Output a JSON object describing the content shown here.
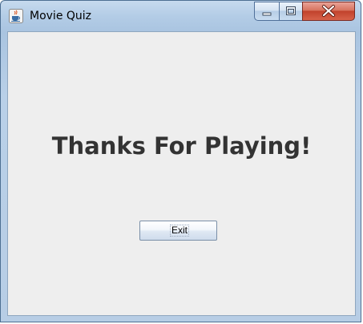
{
  "window": {
    "title": "Movie Quiz"
  },
  "main": {
    "heading": "Thanks For Playing!",
    "exit_label": "Exit"
  },
  "colors": {
    "background": "#eeeeee",
    "heading": "#333333",
    "close_button": "#c1422c"
  }
}
